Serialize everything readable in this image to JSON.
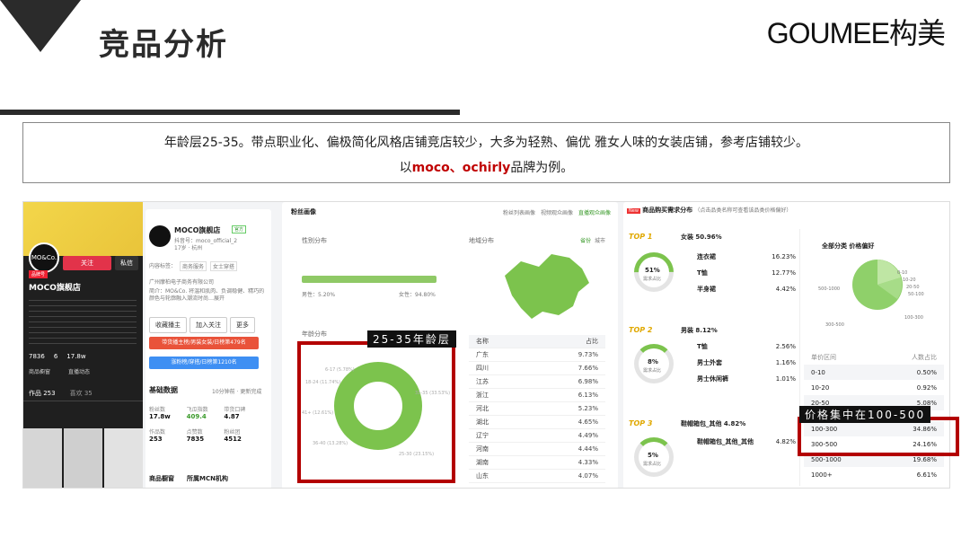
{
  "header": {
    "title": "竞品分析",
    "logo": "GOUMEE构美"
  },
  "summary": {
    "line1": "年龄层25-35。带点职业化、偏极简化风格店铺竞店较少，大多为轻熟、偏优 雅女人味的女装店铺，参考店铺较少。",
    "line2_prefix": "以",
    "line2_brands": "moco、ochirly",
    "line2_suffix": "品牌为例。"
  },
  "colors": {
    "accent_red": "#b30000",
    "brand_red": "#c00000",
    "chart_green": "#7cc34d"
  },
  "left_profile": {
    "shop_name": "MOCO旗舰店",
    "badge": "品牌号",
    "follow_btn": "关注",
    "msg_btn": "私信",
    "stats": [
      "7836",
      "6",
      "17.8w"
    ],
    "tabs": [
      "作品 253",
      "喜欢 35"
    ],
    "labels": [
      "商品橱窗",
      "直播动态"
    ]
  },
  "shop_info": {
    "name": "MOCO旗舰店",
    "verified": "官方",
    "douyin_id": "抖音号：moco_official_2",
    "location": "17岁 · 杭州",
    "tags_label": "内容标签：",
    "tags": [
      "商务服务",
      "女士穿搭"
    ],
    "company": "广州摩柏电子商务有限公司",
    "intro": "简介：MO&Co. 将温和肌肉、负调稳健、精巧的颜色与轮廓融入潮流时尚…展开",
    "actions": [
      "收藏播主",
      "加入关注",
      "更多"
    ],
    "promo1": "带货播主榜/男装女装/日榜第479名",
    "promo2": "涨粉榜/穿搭/日榜第1210名",
    "basic_title": "基础数据",
    "basic_note": "10分钟前 · 更新完成",
    "metrics": [
      {
        "label": "粉丝数",
        "value": "17.8w"
      },
      {
        "label": "飞瓜指数",
        "value": "409.4"
      },
      {
        "label": "带货口碑",
        "value": "4.87"
      },
      {
        "label": "作品数",
        "value": "253"
      },
      {
        "label": "点赞数",
        "value": "7835"
      },
      {
        "label": "粉丝团",
        "value": "4512"
      }
    ],
    "footer": [
      "商品橱窗",
      "所属MCN机构"
    ]
  },
  "fans": {
    "title": "粉丝画像",
    "tabs": [
      "粉丝列表画像",
      "视频观众画像",
      "直播观众画像"
    ],
    "gender_title": "性别分布",
    "male": "男性：5.20%",
    "female": "女性：94.80%",
    "region_title": "地域分布",
    "region_tabs": [
      "省份",
      "城市"
    ],
    "age_title": "年龄分布",
    "age_tag": "25-35年龄层",
    "age_slices": [
      "6-17 (5.78%)",
      "18-24 (11.74%)",
      "31-35 (33.53%)",
      "41+ (12.61%)",
      "36-40 (13.28%)",
      "25-30 (23.15%)"
    ],
    "province_header": [
      "名称",
      "占比"
    ],
    "provinces": [
      [
        "广东",
        "9.73%"
      ],
      [
        "四川",
        "7.66%"
      ],
      [
        "江苏",
        "6.98%"
      ],
      [
        "浙江",
        "6.13%"
      ],
      [
        "河北",
        "5.23%"
      ],
      [
        "湖北",
        "4.65%"
      ],
      [
        "辽宁",
        "4.49%"
      ],
      [
        "河南",
        "4.44%"
      ],
      [
        "湖南",
        "4.33%"
      ],
      [
        "山东",
        "4.07%"
      ]
    ]
  },
  "demand": {
    "title": "商品购买需求分布",
    "note": "（点击品类名称可查看该品类价格偏好）",
    "groups": [
      {
        "rank": "TOP 1",
        "name": "女装 50.96%",
        "pct": "51%",
        "sub": "需求占比",
        "items": [
          [
            "连衣裙",
            "16.23%"
          ],
          [
            "T恤",
            "12.77%"
          ],
          [
            "半身裙",
            "4.42%"
          ]
        ]
      },
      {
        "rank": "TOP 2",
        "name": "男装 8.12%",
        "pct": "8%",
        "sub": "需求占比",
        "items": [
          [
            "T恤",
            "2.56%"
          ],
          [
            "男士外套",
            "1.16%"
          ],
          [
            "男士休闲裤",
            "1.01%"
          ]
        ]
      },
      {
        "rank": "TOP 3",
        "name": "鞋帽箱包_其他 4.82%",
        "pct": "5%",
        "sub": "需求占比",
        "items": [
          [
            "鞋帽箱包_其他_其他",
            "4.82%"
          ]
        ]
      }
    ]
  },
  "price": {
    "title": "全部分类 价格偏好",
    "pie_labels": [
      "500-1000",
      "0-10",
      "10-20",
      "20-50",
      "50-100",
      "100-300",
      "300-500"
    ],
    "header": [
      "单价区间",
      "人数占比"
    ],
    "rows": [
      [
        "0-10",
        "0.50%"
      ],
      [
        "10-20",
        "0.92%"
      ],
      [
        "20-50",
        "5.08%"
      ],
      [
        "100-300",
        "34.86%"
      ],
      [
        "300-500",
        "24.16%"
      ],
      [
        "500-1000",
        "19.68%"
      ],
      [
        "1000+",
        "6.61%"
      ]
    ],
    "tag": "价格集中在100-500"
  }
}
